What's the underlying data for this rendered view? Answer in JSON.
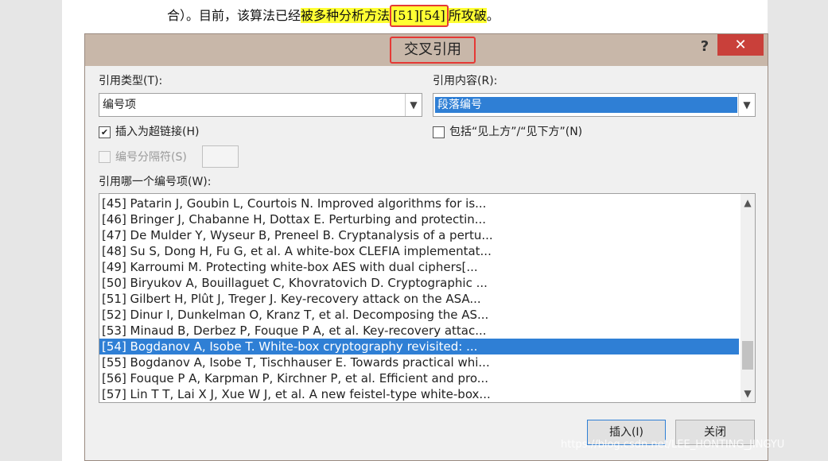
{
  "document": {
    "text_before": "合）。目前，该算法已经",
    "highlight_text": "被多种分析方法",
    "cite": "[51][54]",
    "highlight_after": "所攻破",
    "text_end": "。"
  },
  "dialog": {
    "title": "交叉引用",
    "help": "?",
    "close": "✕",
    "ref_type_label": "引用类型(T):",
    "ref_type_value": "编号项",
    "ref_content_label": "引用内容(R):",
    "ref_content_value": "段落编号",
    "insert_hyperlink_label": "插入为超链接(H)",
    "insert_hyperlink_checked": true,
    "include_above_below_label": "包括“见上方”/“见下方”(N)",
    "include_above_below_checked": false,
    "separator_label": "编号分隔符(S)",
    "which_item_label": "引用哪一个编号项(W):",
    "items": [
      "[45] Patarin J, Goubin L, Courtois N. Improved algorithms for is...",
      "[46] Bringer J, Chabanne H, Dottax E. Perturbing and protectin...",
      "[47] De Mulder Y, Wyseur B, Preneel B. Cryptanalysis of a pertu...",
      "[48] Su S, Dong H, Fu G, et al. A white-box CLEFIA implementat...",
      "[49] Karroumi M. Protecting white-box AES with dual ciphers[...",
      "[50] Biryukov A, Bouillaguet C, Khovratovich D. Cryptographic ...",
      "[51] Gilbert H, Plût J, Treger J. Key-recovery attack on the ASA...",
      "[52] Dinur I, Dunkelman O, Kranz T, et al. Decomposing the AS...",
      "[53] Minaud B, Derbez P, Fouque P A, et al. Key-recovery attac...",
      "[54] Bogdanov A, Isobe T. White-box cryptography revisited: ...",
      "[55] Bogdanov A, Isobe T, Tischhauser E. Towards practical whi...",
      "[56] Fouque P A, Karpman P, Kirchner P, et al. Efficient and pro...",
      "[57] Lin T T, Lai X J, Xue W J, et al. A new feistel-type white-box..."
    ],
    "selected_index": 9,
    "insert_button": "插入(I)",
    "close_button": "关闭"
  },
  "watermark": "https://blog.csdn.net/LEE_HONTING_JINGYU",
  "colors": {
    "highlight": "#ffff33",
    "selection": "#2f7fd5",
    "annotation_red": "#e53935",
    "close_red": "#c9403a"
  }
}
